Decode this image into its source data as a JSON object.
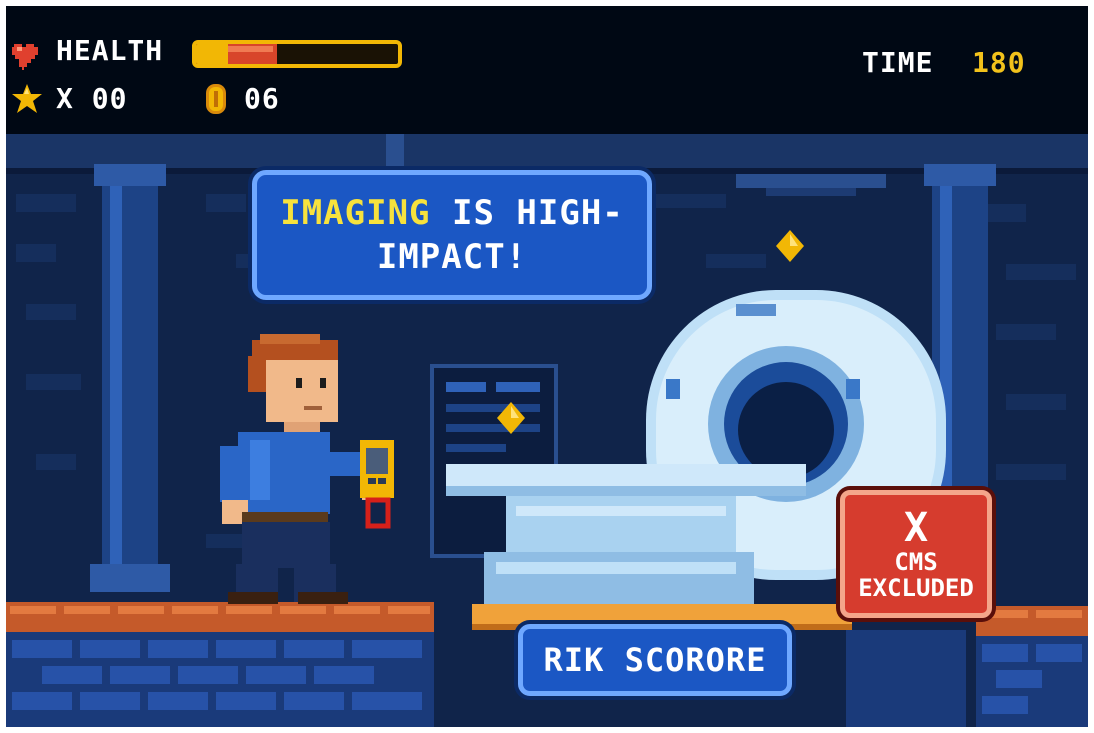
{
  "hud": {
    "health_label": "HEALTH",
    "health_fraction": 0.4,
    "lives_label": "X 00",
    "coins_label": "06",
    "time_label": "TIME",
    "time_value": "180",
    "icons": {
      "health": "heart-icon",
      "lives": "star-icon",
      "coins": "coin-icon"
    }
  },
  "scene": {
    "speech": {
      "highlight": "IMAGING",
      "line1_rest": " IS HIGH-",
      "line2": "IMPACT!"
    },
    "risk_button_label": "RIK SCORORE",
    "cms_badge": {
      "icon": "x-icon",
      "mark": "X",
      "line1": "CMS",
      "line2": "EXCLUDED"
    }
  },
  "colors": {
    "hud_bg": "#000814",
    "accent_yellow": "#f2c21b",
    "bubble_blue": "#1b57c4",
    "badge_red": "#d63c2e"
  }
}
